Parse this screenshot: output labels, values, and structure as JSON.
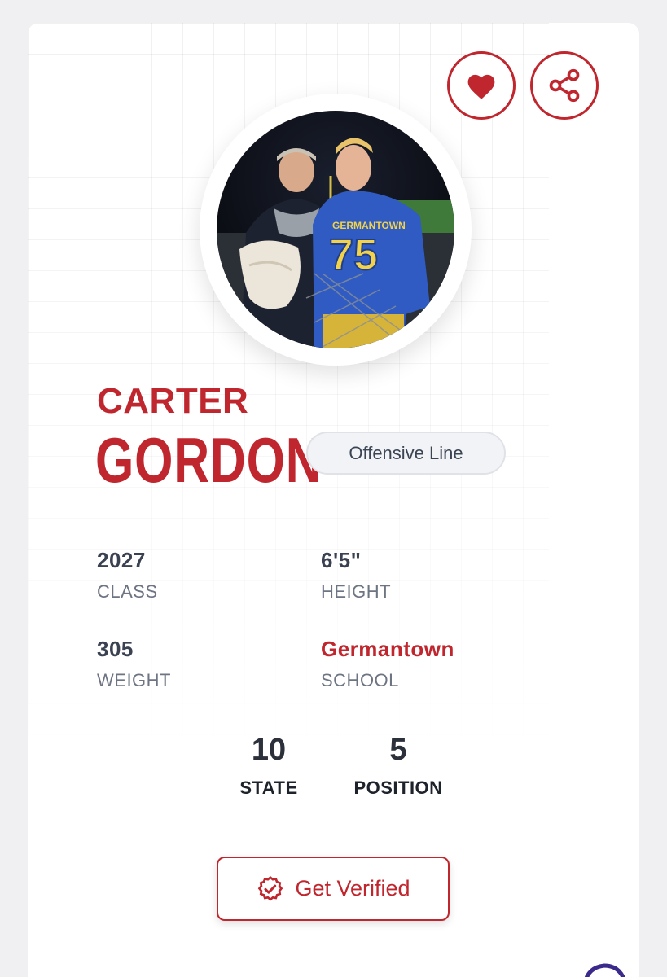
{
  "actions": {
    "favorite_icon": "heart-icon",
    "share_icon": "share-icon"
  },
  "player": {
    "first_name": "CARTER",
    "last_name": "GORDON",
    "position_badge": "Offensive Line",
    "photo_icon": "player-photo"
  },
  "stats": {
    "class": {
      "value": "2027",
      "label": "CLASS"
    },
    "height": {
      "value": "6'5\"",
      "label": "HEIGHT"
    },
    "weight": {
      "value": "305",
      "label": "WEIGHT"
    },
    "school": {
      "value": "Germantown",
      "label": "SCHOOL"
    }
  },
  "rankings": {
    "state": {
      "value": "10",
      "label": "STATE"
    },
    "position": {
      "value": "5",
      "label": "POSITION"
    }
  },
  "verify": {
    "label": "Get Verified",
    "icon": "verified-badge-icon"
  },
  "colors": {
    "accent": "#c0262d",
    "text_dark": "#3a4150",
    "text_muted": "#6d7482"
  }
}
